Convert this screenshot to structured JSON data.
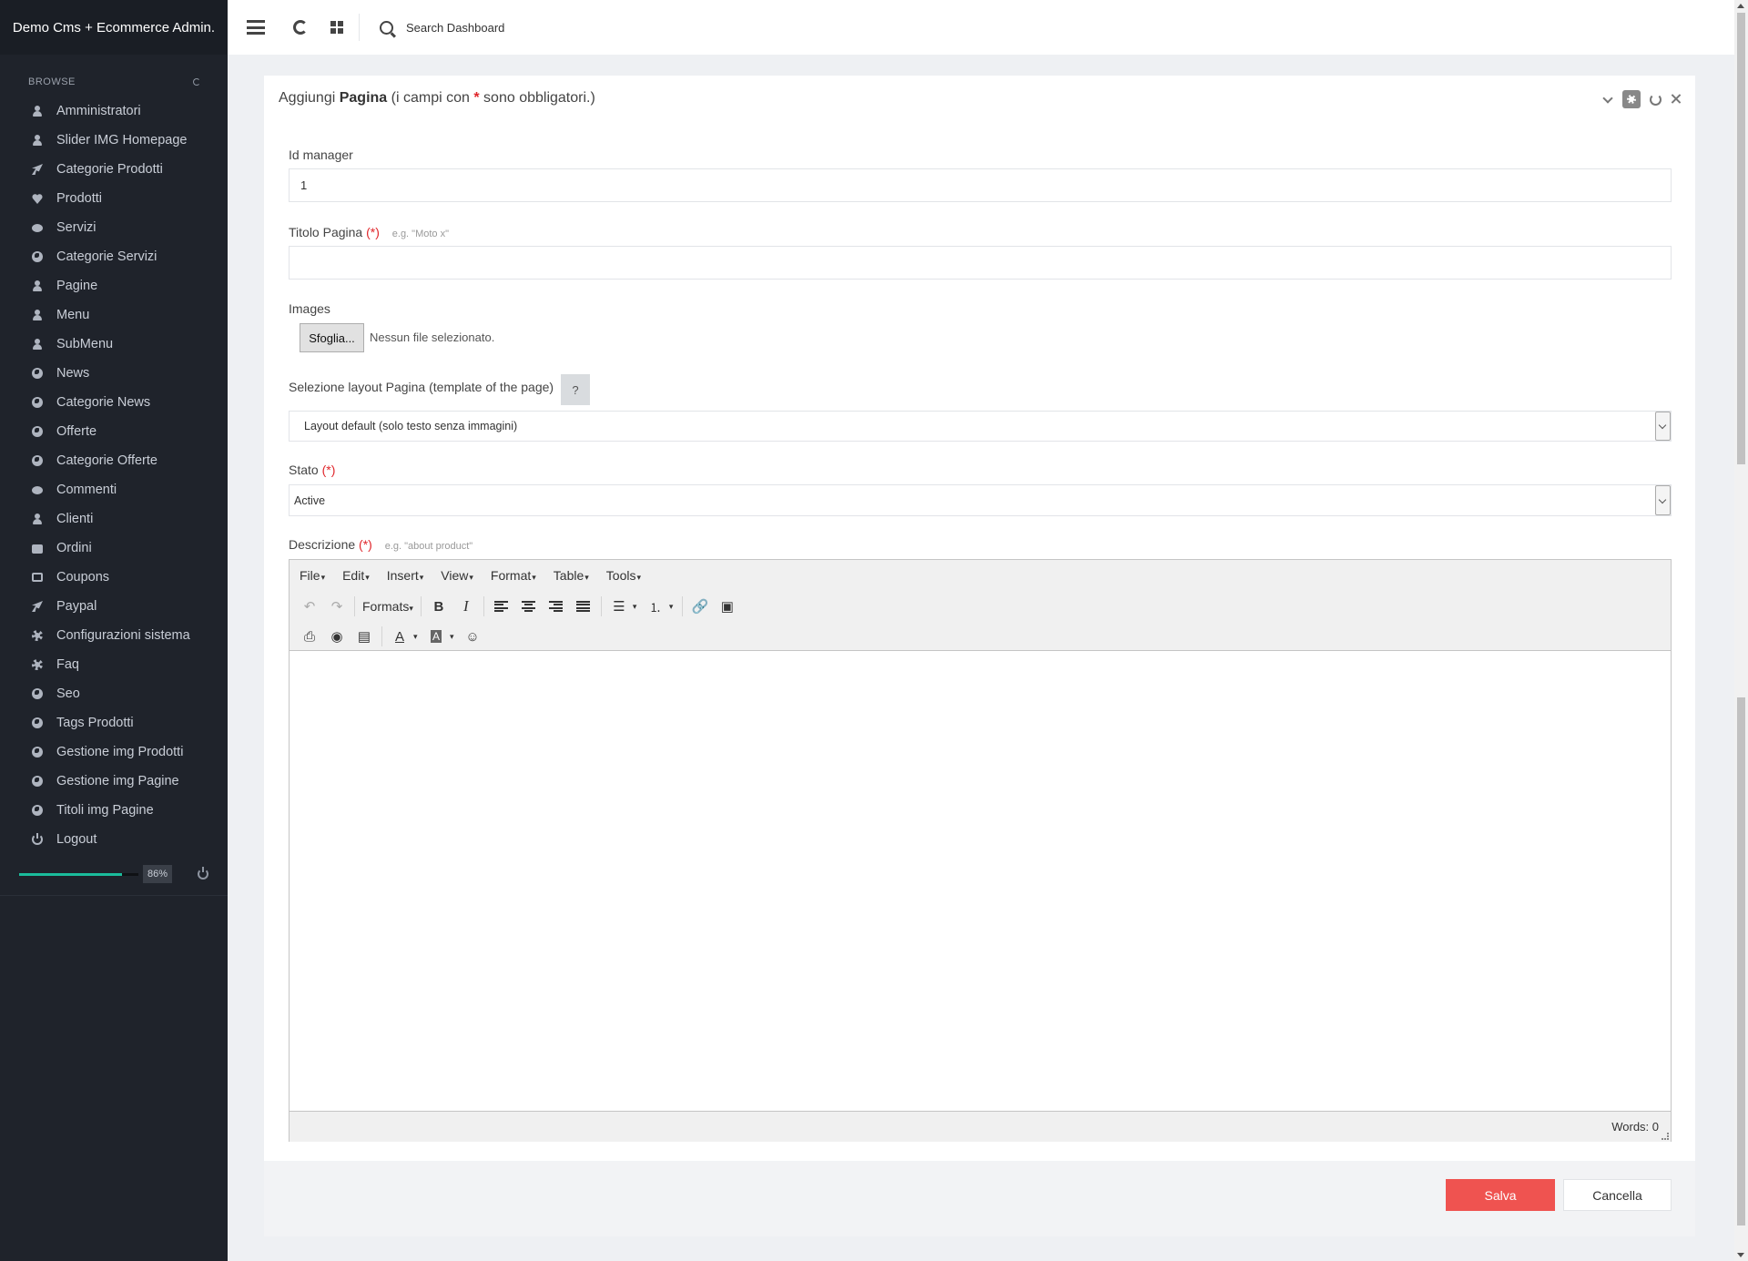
{
  "sidebar": {
    "brand": "Demo Cms + Ecommerce Admin.",
    "browse_label": "BROWSE",
    "items": [
      {
        "label": "Amministratori",
        "icon": "user-icon"
      },
      {
        "label": "Slider IMG Homepage",
        "icon": "user-icon"
      },
      {
        "label": "Categorie Prodotti",
        "icon": "rocket-icon"
      },
      {
        "label": "Prodotti",
        "icon": "heart-icon"
      },
      {
        "label": "Servizi",
        "icon": "comments-icon"
      },
      {
        "label": "Categorie Servizi",
        "icon": "globe-icon"
      },
      {
        "label": "Pagine",
        "icon": "user-icon"
      },
      {
        "label": "Menu",
        "icon": "user-icon"
      },
      {
        "label": "SubMenu",
        "icon": "user-icon"
      },
      {
        "label": "News",
        "icon": "globe-icon"
      },
      {
        "label": "Categorie News",
        "icon": "globe-icon"
      },
      {
        "label": "Offerte",
        "icon": "globe-icon"
      },
      {
        "label": "Categorie Offerte",
        "icon": "globe-icon"
      },
      {
        "label": "Commenti",
        "icon": "comments-icon"
      },
      {
        "label": "Clienti",
        "icon": "user-icon"
      },
      {
        "label": "Ordini",
        "icon": "briefcase-icon"
      },
      {
        "label": "Coupons",
        "icon": "coupon-icon"
      },
      {
        "label": "Paypal",
        "icon": "rocket-icon"
      },
      {
        "label": "Configurazioni sistema",
        "icon": "gear-icon"
      },
      {
        "label": "Faq",
        "icon": "gear-icon"
      },
      {
        "label": "Seo",
        "icon": "globe-icon"
      },
      {
        "label": "Tags Prodotti",
        "icon": "globe-icon"
      },
      {
        "label": "Gestione img Prodotti",
        "icon": "globe-icon"
      },
      {
        "label": "Gestione img Pagine",
        "icon": "globe-icon"
      },
      {
        "label": "Titoli img Pagine",
        "icon": "globe-icon"
      },
      {
        "label": "Logout",
        "icon": "power-icon"
      }
    ],
    "progress": {
      "percent_label": "86%",
      "fraction": 0.86
    }
  },
  "topbar": {
    "search_placeholder": "Search Dashboard"
  },
  "panel": {
    "title_prefix": "Aggiungi",
    "title_bold": "Pagina",
    "title_mid": "(i campi con",
    "title_star": "*",
    "title_suffix": "sono obbligatori.)",
    "fields": {
      "id_manager": {
        "label": "Id manager",
        "value": "1"
      },
      "titolo": {
        "label": "Titolo Pagina",
        "req": "(*)",
        "hint": "e.g. \"Moto x\"",
        "value": ""
      },
      "images": {
        "label": "Images",
        "button": "Sfoglia...",
        "status": "Nessun file selezionato."
      },
      "layout": {
        "label": "Selezione layout Pagina (template of the page)",
        "help": "?",
        "value": "Layout default (solo testo senza immagini)"
      },
      "stato": {
        "label": "Stato",
        "req": "(*)",
        "value": "Active"
      },
      "descrizione": {
        "label": "Descrizione",
        "req": "(*)",
        "hint": "e.g. \"about product\""
      }
    },
    "editor": {
      "menus": [
        "File",
        "Edit",
        "Insert",
        "View",
        "Format",
        "Table",
        "Tools"
      ],
      "formats_label": "Formats",
      "words": "Words: 0"
    },
    "footer": {
      "save": "Salva",
      "cancel": "Cancella"
    }
  },
  "colors": {
    "sidebar_bg": "#1f232b",
    "accent": "#1abc9c",
    "save_button": "#ef5350",
    "required": "#e0262b"
  }
}
